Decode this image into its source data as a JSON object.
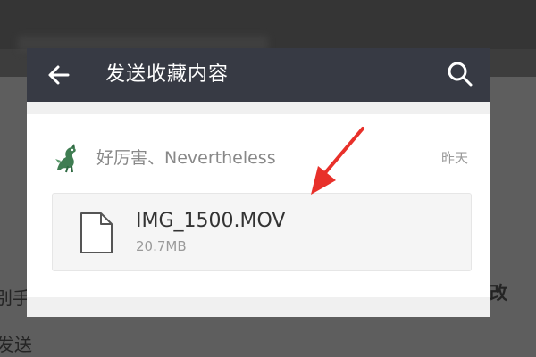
{
  "header": {
    "title": "发送收藏内容",
    "back_icon": "arrow-left-icon",
    "search_icon": "search-icon"
  },
  "item": {
    "sender": "好厉害、Nevertheless",
    "date": "昨天",
    "file": {
      "name": "IMG_1500.MOV",
      "size": "20.7MB",
      "icon": "file-icon"
    }
  },
  "background": {
    "left_text_1": "别手",
    "left_text_2": "发送",
    "right_text": "改"
  },
  "colors": {
    "header_bg": "#373a44",
    "annotation_arrow": "#e8302a"
  }
}
